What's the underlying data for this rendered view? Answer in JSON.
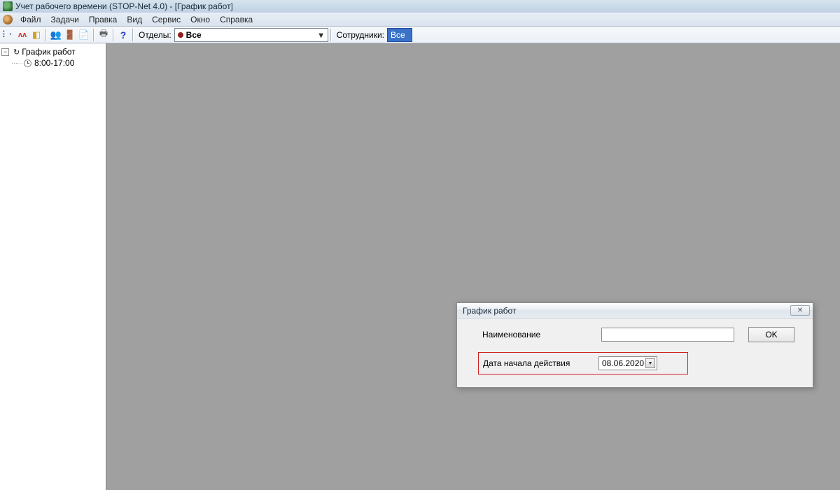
{
  "titlebar": {
    "text": "Учет рабочего времени (STOP-Net 4.0) - [График работ]"
  },
  "menu": {
    "items": [
      "Файл",
      "Задачи",
      "Правка",
      "Вид",
      "Сервис",
      "Окно",
      "Справка"
    ]
  },
  "toolbar": {
    "dept_label": "Отделы:",
    "dept_value": "Все",
    "emp_label": "Сотрудники:",
    "emp_value": "Все"
  },
  "tree": {
    "root": "График работ",
    "child": "8:00-17:00"
  },
  "dialog": {
    "title": "График работ",
    "name_label": "Наименование",
    "name_value": "",
    "ok_label": "OK",
    "date_label": "Дата начала действия",
    "date_value": "08.06.2020"
  }
}
